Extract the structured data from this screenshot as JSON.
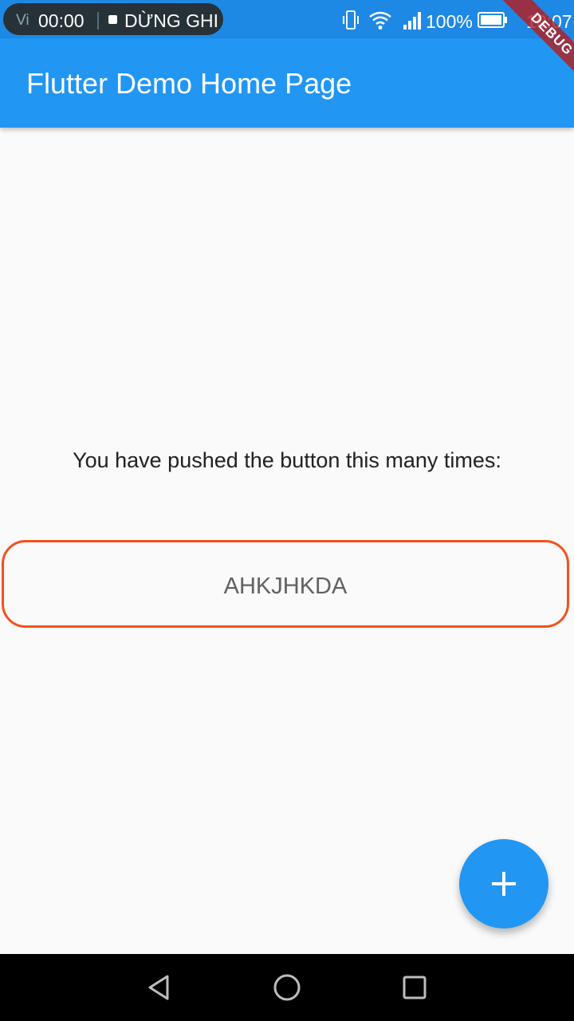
{
  "status_bar": {
    "recorder_ghost": "Vi",
    "recorder_time": "00:00",
    "recorder_stop_label": "DỪNG GHI",
    "battery_percent": "100%",
    "clock": "10:07"
  },
  "app_bar": {
    "title": "Flutter Demo Home Page",
    "debug_banner": "DEBUG"
  },
  "body": {
    "prompt": "You have pushed the button this many times:",
    "counter_text": "AHKJHKDA"
  },
  "fab": {
    "icon": "plus-icon",
    "color": "#2196f3"
  },
  "nav_bar": {
    "icons": [
      "back-icon",
      "home-icon",
      "recents-icon"
    ]
  },
  "colors": {
    "primary": "#2196f3",
    "status_bar": "#1e88e5",
    "counter_border": "#f4511e",
    "background": "#fafafa"
  }
}
